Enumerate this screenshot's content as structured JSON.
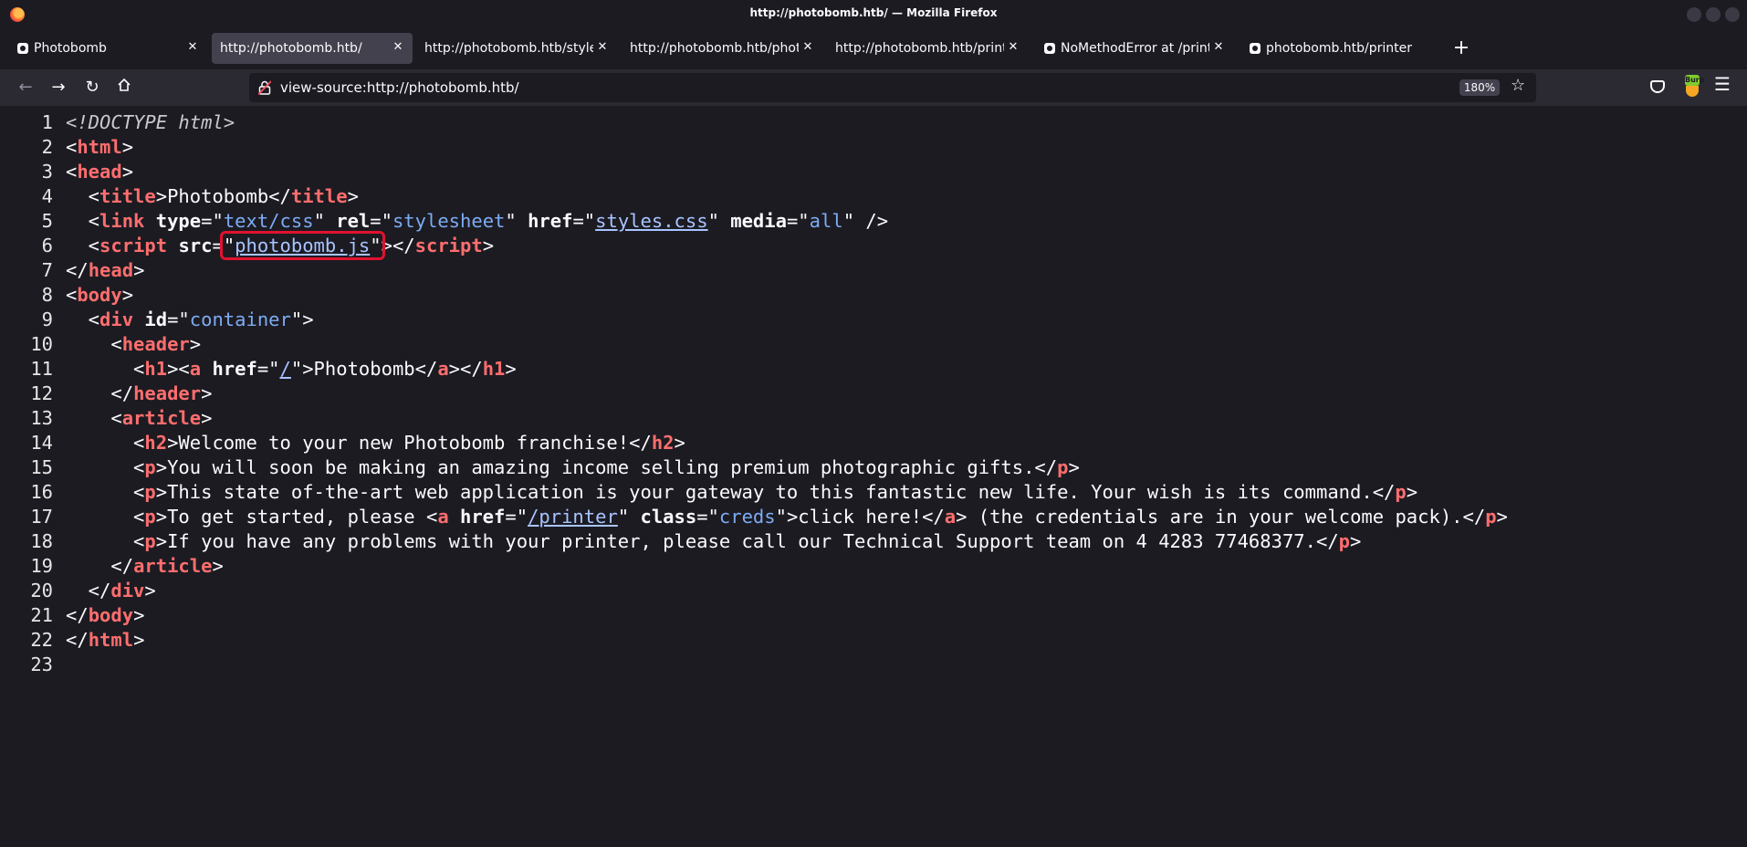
{
  "window": {
    "title": "http://photobomb.htb/ — Mozilla Firefox"
  },
  "tabs": [
    {
      "label": "Photobomb",
      "active": false
    },
    {
      "label": "http://photobomb.htb/",
      "active": true
    },
    {
      "label": "http://photobomb.htb/styles.css",
      "active": false
    },
    {
      "label": "http://photobomb.htb/photobomb.js",
      "active": false
    },
    {
      "label": "http://photobomb.htb/printer",
      "active": false
    },
    {
      "label": "NoMethodError at /printer",
      "active": false
    },
    {
      "label": "photobomb.htb/printer/w",
      "active": false
    }
  ],
  "navbar": {
    "url": "view-source:http://photobomb.htb/",
    "zoom": "180%",
    "burp_label": "Burp"
  },
  "source_lines": [
    {
      "n": "1",
      "p": [
        [
          "doc",
          "<!DOCTYPE html>"
        ]
      ]
    },
    {
      "n": "2",
      "p": [
        [
          "",
          "<"
        ],
        [
          "t",
          "html"
        ],
        [
          "",
          ">"
        ]
      ]
    },
    {
      "n": "3",
      "p": [
        [
          "",
          "<"
        ],
        [
          "t",
          "head"
        ],
        [
          "",
          ">"
        ]
      ]
    },
    {
      "n": "4",
      "p": [
        [
          "",
          "  <"
        ],
        [
          "t",
          "title"
        ],
        [
          "",
          ">Photobomb</"
        ],
        [
          "t",
          "title"
        ],
        [
          "",
          ">"
        ]
      ]
    },
    {
      "n": "5",
      "p": [
        [
          "",
          "  <"
        ],
        [
          "t",
          "link"
        ],
        [
          "",
          " "
        ],
        [
          "a",
          "type"
        ],
        [
          "",
          "=\""
        ],
        [
          "v",
          "text/css"
        ],
        [
          "",
          "\" "
        ],
        [
          "a",
          "rel"
        ],
        [
          "",
          "=\""
        ],
        [
          "v",
          "stylesheet"
        ],
        [
          "",
          "\" "
        ],
        [
          "a",
          "href"
        ],
        [
          "",
          "=\""
        ],
        [
          "lnk",
          "styles.css"
        ],
        [
          "",
          "\" "
        ],
        [
          "a",
          "media"
        ],
        [
          "",
          "=\""
        ],
        [
          "v",
          "all"
        ],
        [
          "",
          "\" />"
        ]
      ]
    },
    {
      "n": "6",
      "p": [
        [
          "",
          "  <"
        ],
        [
          "t",
          "script"
        ],
        [
          "",
          " "
        ],
        [
          "a",
          "src"
        ],
        [
          "",
          "="
        ],
        [
          "hl",
          "\"|photobomb.js|\""
        ],
        [
          "",
          "></"
        ],
        [
          "t",
          "script"
        ],
        [
          "",
          ">"
        ]
      ]
    },
    {
      "n": "7",
      "p": [
        [
          "",
          "</"
        ],
        [
          "t",
          "head"
        ],
        [
          "",
          ">"
        ]
      ]
    },
    {
      "n": "8",
      "p": [
        [
          "",
          "<"
        ],
        [
          "t",
          "body"
        ],
        [
          "",
          ">"
        ]
      ]
    },
    {
      "n": "9",
      "p": [
        [
          "",
          "  <"
        ],
        [
          "t",
          "div"
        ],
        [
          "",
          " "
        ],
        [
          "a",
          "id"
        ],
        [
          "",
          "=\""
        ],
        [
          "v",
          "container"
        ],
        [
          "",
          "\">"
        ]
      ]
    },
    {
      "n": "10",
      "p": [
        [
          "",
          "    <"
        ],
        [
          "t",
          "header"
        ],
        [
          "",
          ">"
        ]
      ]
    },
    {
      "n": "11",
      "p": [
        [
          "",
          "      <"
        ],
        [
          "t",
          "h1"
        ],
        [
          "",
          "><"
        ],
        [
          "t",
          "a"
        ],
        [
          "",
          " "
        ],
        [
          "a",
          "href"
        ],
        [
          "",
          "=\""
        ],
        [
          "lnk",
          "/"
        ],
        [
          "",
          "\">Photobomb</"
        ],
        [
          "t",
          "a"
        ],
        [
          "",
          "></"
        ],
        [
          "t",
          "h1"
        ],
        [
          "",
          ">"
        ]
      ]
    },
    {
      "n": "12",
      "p": [
        [
          "",
          "    </"
        ],
        [
          "t",
          "header"
        ],
        [
          "",
          ">"
        ]
      ]
    },
    {
      "n": "13",
      "p": [
        [
          "",
          "    <"
        ],
        [
          "t",
          "article"
        ],
        [
          "",
          ">"
        ]
      ]
    },
    {
      "n": "14",
      "p": [
        [
          "",
          "      <"
        ],
        [
          "t",
          "h2"
        ],
        [
          "",
          ">Welcome to your new Photobomb franchise!</"
        ],
        [
          "t",
          "h2"
        ],
        [
          "",
          ">"
        ]
      ]
    },
    {
      "n": "15",
      "p": [
        [
          "",
          "      <"
        ],
        [
          "t",
          "p"
        ],
        [
          "",
          ">You will soon be making an amazing income selling premium photographic gifts.</"
        ],
        [
          "t",
          "p"
        ],
        [
          "",
          ">"
        ]
      ]
    },
    {
      "n": "16",
      "p": [
        [
          "",
          "      <"
        ],
        [
          "t",
          "p"
        ],
        [
          "",
          ">This state of-the-art web application is your gateway to this fantastic new life. Your wish is its command.</"
        ],
        [
          "t",
          "p"
        ],
        [
          "",
          ">"
        ]
      ]
    },
    {
      "n": "17",
      "p": [
        [
          "",
          "      <"
        ],
        [
          "t",
          "p"
        ],
        [
          "",
          ">To get started, please <"
        ],
        [
          "t",
          "a"
        ],
        [
          "",
          " "
        ],
        [
          "a",
          "href"
        ],
        [
          "",
          "=\""
        ],
        [
          "lnk",
          "/printer"
        ],
        [
          "",
          "\" "
        ],
        [
          "a",
          "class"
        ],
        [
          "",
          "=\""
        ],
        [
          "v",
          "creds"
        ],
        [
          "",
          "\">click here!</"
        ],
        [
          "t",
          "a"
        ],
        [
          "",
          "> (the credentials are in your welcome pack).</"
        ],
        [
          "t",
          "p"
        ],
        [
          "",
          ">"
        ]
      ]
    },
    {
      "n": "18",
      "p": [
        [
          "",
          "      <"
        ],
        [
          "t",
          "p"
        ],
        [
          "",
          ">If you have any problems with your printer, please call our Technical Support team on 4 4283 77468377.</"
        ],
        [
          "t",
          "p"
        ],
        [
          "",
          ">"
        ]
      ]
    },
    {
      "n": "19",
      "p": [
        [
          "",
          "    </"
        ],
        [
          "t",
          "article"
        ],
        [
          "",
          ">"
        ]
      ]
    },
    {
      "n": "20",
      "p": [
        [
          "",
          "  </"
        ],
        [
          "t",
          "div"
        ],
        [
          "",
          ">"
        ]
      ]
    },
    {
      "n": "21",
      "p": [
        [
          "",
          "</"
        ],
        [
          "t",
          "body"
        ],
        [
          "",
          ">"
        ]
      ]
    },
    {
      "n": "22",
      "p": [
        [
          "",
          "</"
        ],
        [
          "t",
          "html"
        ],
        [
          "",
          ">"
        ]
      ]
    },
    {
      "n": "23",
      "p": []
    }
  ],
  "colors": {
    "chrome_bg": "#1c1b22",
    "toolbar_bg": "#2b2a33",
    "active_tab": "#42414d",
    "tag": "#ff6e6e",
    "attr_value": "#7dacf4",
    "link": "#a8c4ff",
    "highlight_box": "#e0122e"
  }
}
